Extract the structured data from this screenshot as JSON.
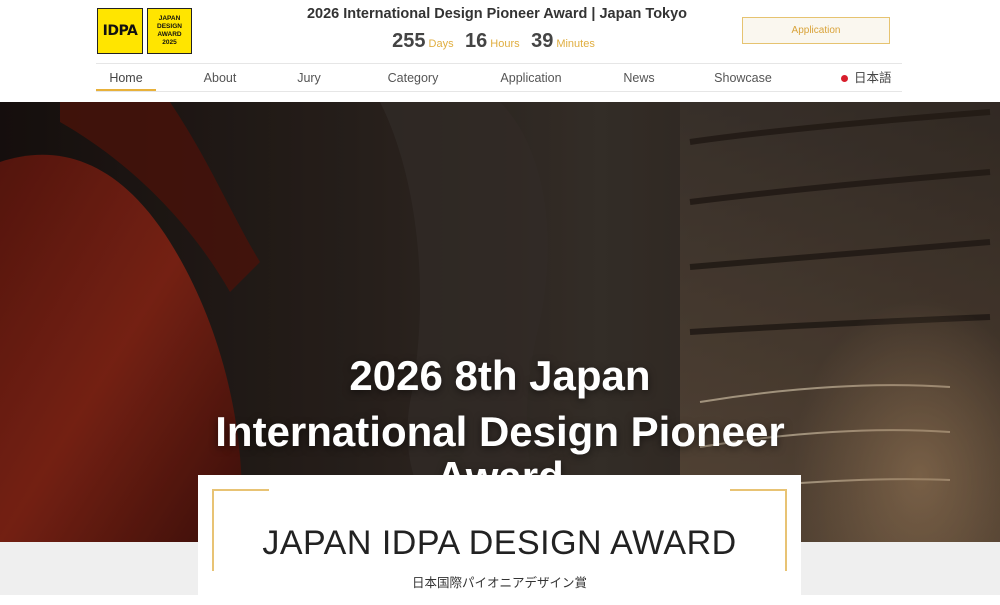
{
  "header": {
    "logo_text": "IDPA",
    "badge_lines": [
      "JAPAN",
      "DESIGN",
      "AWARD",
      "2025"
    ],
    "title": "2026 International Design Pioneer Award | Japan Tokyo",
    "countdown": [
      {
        "value": "255",
        "unit": "Days"
      },
      {
        "value": "16",
        "unit": "Hours"
      },
      {
        "value": "39",
        "unit": "Minutes"
      }
    ],
    "application_button": "Application"
  },
  "nav": {
    "items": [
      "Home",
      "About",
      "Jury",
      "Category",
      "Application",
      "News",
      "Showcase"
    ],
    "active": "Home",
    "language": "日本語"
  },
  "hero": {
    "line1": "2026 8th Japan",
    "line2": "International Design Pioneer",
    "line3": "Award"
  },
  "intro_card": {
    "title": "JAPAN IDPA DESIGN AWARD",
    "subtitle": "日本国際パイオニアデザイン賞"
  },
  "colors": {
    "accent_gold": "#e8b13a",
    "logo_yellow": "#ffe500",
    "flag_red": "#d81e2c"
  }
}
